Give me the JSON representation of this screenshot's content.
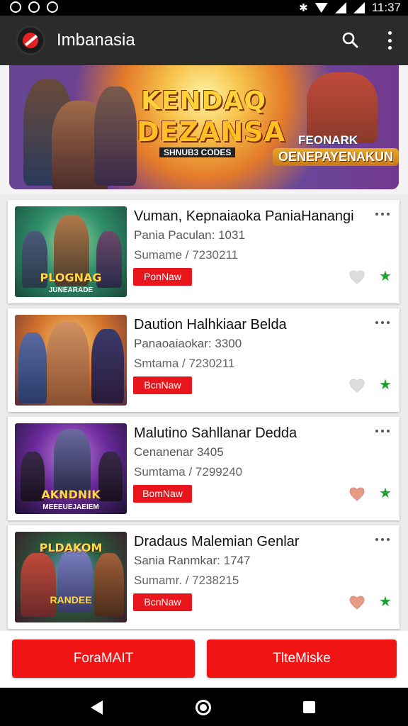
{
  "status_bar": {
    "time": "11:37",
    "left_icons": [
      "notification-icon",
      "notification-icon",
      "notification-icon"
    ],
    "right_icons": [
      "bluetooth-icon",
      "wifi-icon",
      "signal-icon",
      "signal-icon"
    ]
  },
  "app_bar": {
    "title": "Imbanasia",
    "accent": "#e5221f"
  },
  "hero": {
    "title_line1": "KENDAQ",
    "title_line2": "DEZANSA",
    "subtitle": "SHNUB3 CODES",
    "banner_line1": "FEONARK",
    "banner_line2": "OENEPAYENAKUN"
  },
  "cards": [
    {
      "title": "Vuman, Kepnaiaoka PaniaHanangi",
      "line1": "Pania Paculan: 1031",
      "line2": "Sumame / 7230211",
      "button": "PonNaw",
      "thumb_title": "PLOGNAG",
      "thumb_sub": "JUNEARADE",
      "heart_color": "#dddddd",
      "star_color": "#1ea12f"
    },
    {
      "title": "Daution Halhkiaar Belda",
      "line1": "Panaoaiaokar: 3300",
      "line2": "Smtama / 7230211",
      "button": "BcnNaw",
      "thumb_title": "",
      "thumb_sub": "",
      "heart_color": "#dddddd",
      "star_color": "#1ea12f"
    },
    {
      "title": "Malutino Sahllanar Dedda",
      "line1": "Cenanenar 3405",
      "line2": "Sumtama / 7299240",
      "button": "BomNaw",
      "thumb_title": "AKNDNIK",
      "thumb_sub": "MEEEUEJAEIEM",
      "heart_color": "#e69b83",
      "star_color": "#1ea12f"
    },
    {
      "title": "Dradaus Malemian Genlar",
      "line1": "Sania Ranmkar: 1747",
      "line2": "Sumamr. / 7238215",
      "button": "BcnNaw",
      "thumb_title": "PLDAKOM",
      "thumb_sub": "RANDEE",
      "heart_color": "#e69b83",
      "star_color": "#1ea12f"
    }
  ],
  "bottom_buttons": {
    "left": "ForaMAIT",
    "right": "TlteMiske"
  },
  "nav_bar": {
    "back": "back-icon",
    "home": "home-icon",
    "recent": "recent-apps-icon"
  }
}
